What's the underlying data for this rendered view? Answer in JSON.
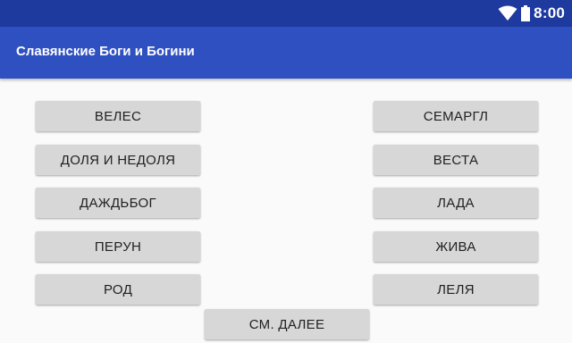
{
  "status_bar": {
    "time": "8:00",
    "icons": [
      "wifi-icon",
      "battery-icon"
    ]
  },
  "app_bar": {
    "title": "Славянские Боги и Богини"
  },
  "gods": [
    "ВЕЛЕС",
    "ДОЛЯ И НЕДОЛЯ",
    "ДАЖДЬБОГ",
    "ПЕРУН",
    "РОД"
  ],
  "goddesses": [
    "СЕМАРГЛ",
    "ВЕСТА",
    "ЛАДА",
    "ЖИВА",
    "ЛЕЛЯ"
  ],
  "more_button": "СМ. ДАЛЕЕ",
  "colors": {
    "status_bar": "#1e3a9e",
    "app_bar": "#2f50c0",
    "button": "#d7d7d7",
    "background": "#fafafa"
  }
}
